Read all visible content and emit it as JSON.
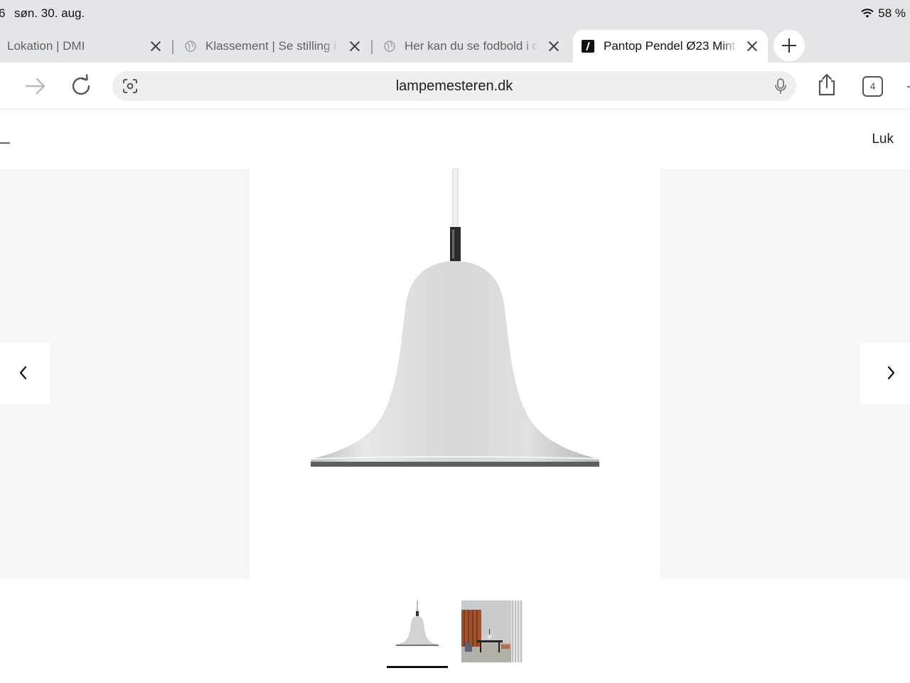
{
  "status_bar": {
    "time_fragment": "6",
    "date": "søn. 30. aug.",
    "battery": "58 %"
  },
  "tabs": [
    {
      "title": "Lokation | DMI",
      "active": false
    },
    {
      "title": "Klassement | Se stilling i",
      "active": false
    },
    {
      "title": "Her kan du se fodbold i d",
      "active": false
    },
    {
      "title": "Pantop Pendel Ø23 Mint",
      "active": true
    }
  ],
  "toolbar": {
    "url": "lampemesteren.dk",
    "tab_count": "4",
    "icons": [
      "forward-icon",
      "reload-icon",
      "page-tools-icon",
      "microphone-icon",
      "share-icon",
      "tab-overview-icon"
    ]
  },
  "gallery": {
    "close_label": "Luk",
    "prev_icon": "chevron-left-icon",
    "next_icon": "chevron-right-icon",
    "lamp_color": "#d6d9d8",
    "thumbnails": [
      {
        "name": "product-thumbnail",
        "selected": true
      },
      {
        "name": "interior-thumbnail",
        "selected": false
      }
    ]
  },
  "colors": {
    "chrome_background": "#e3e5e8",
    "address_bar": "#eeeff1",
    "side_panel": "#f6f6f6"
  }
}
